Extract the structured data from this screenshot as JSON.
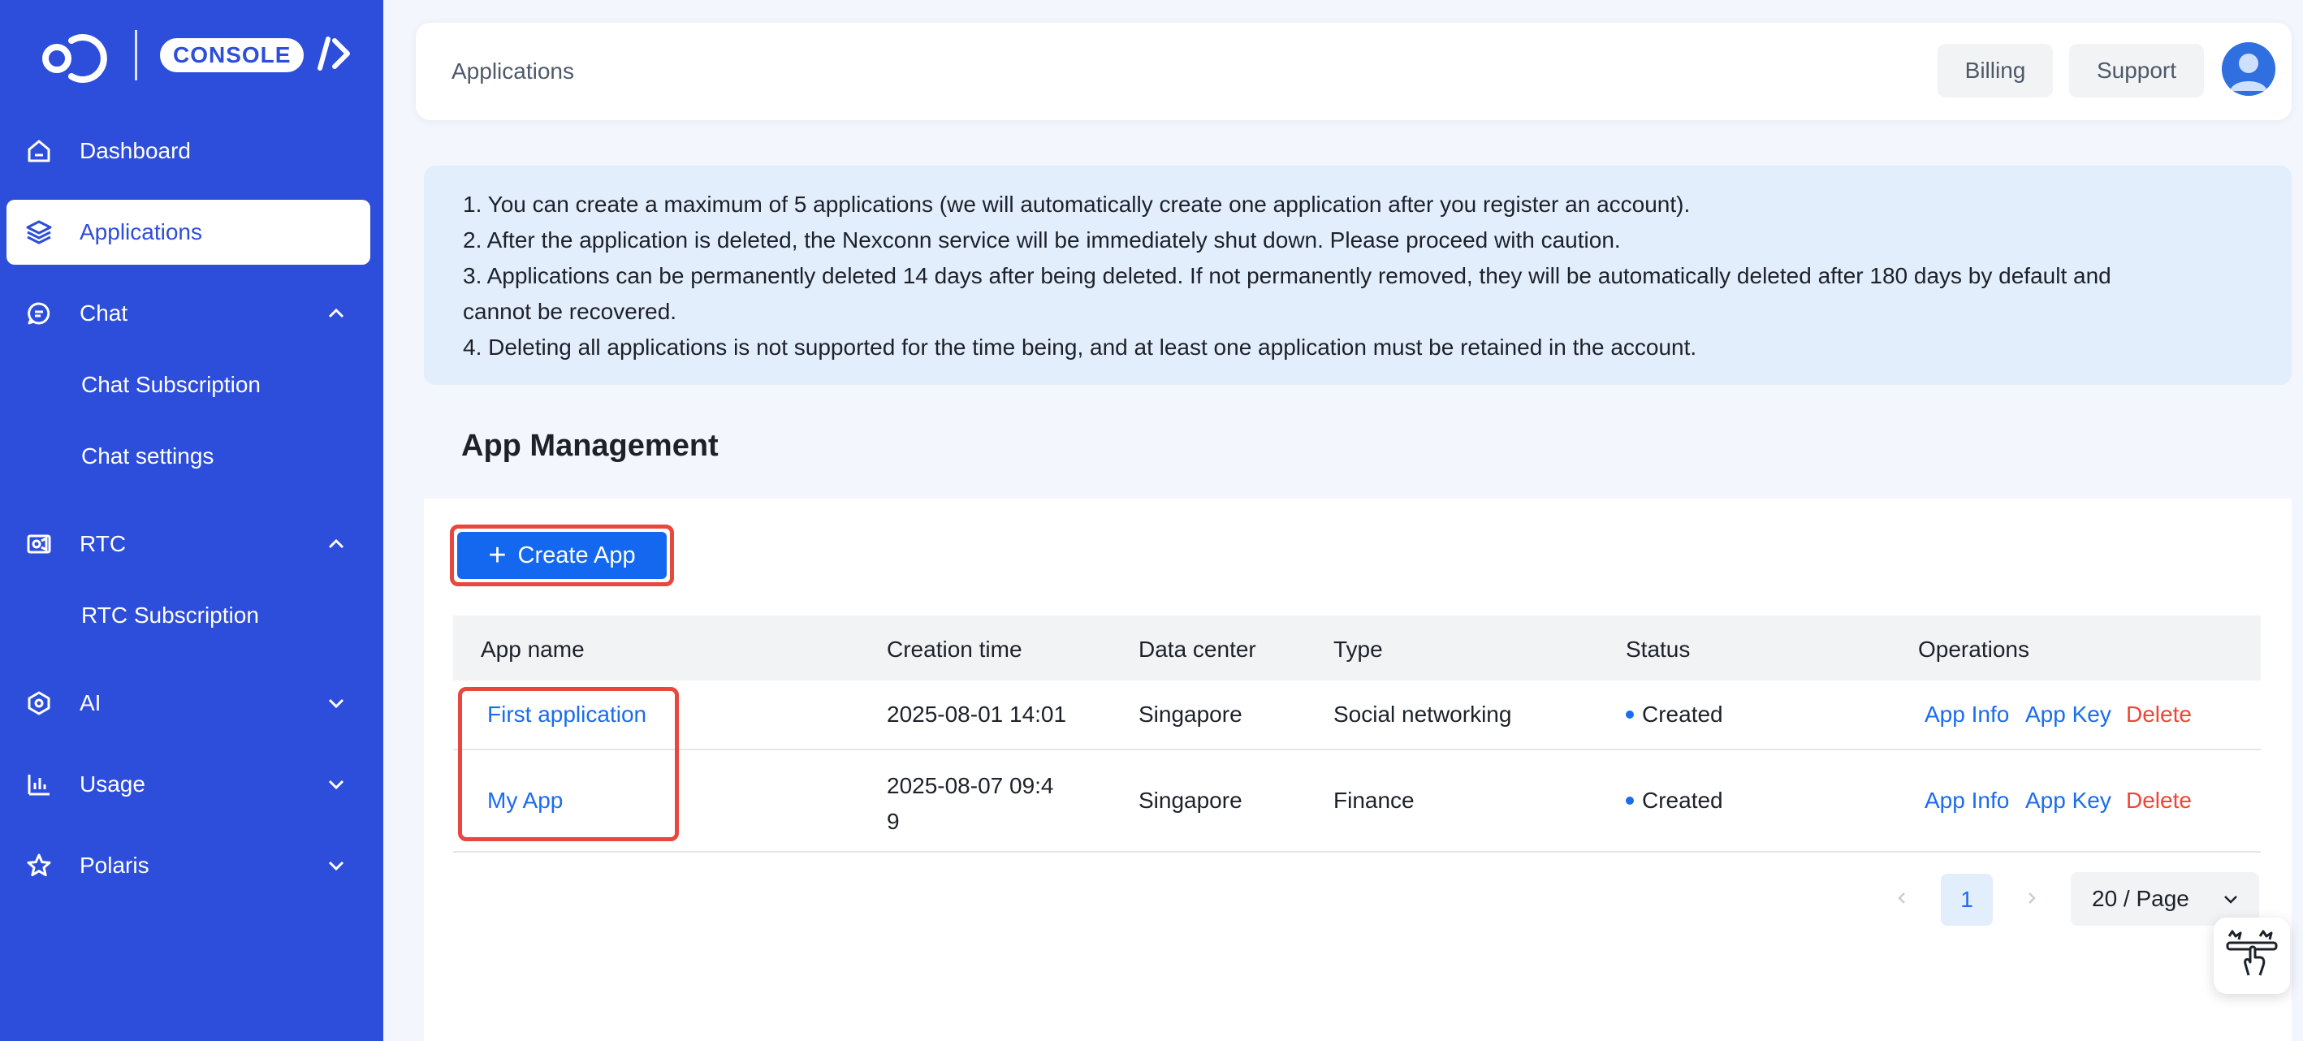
{
  "brand": {
    "badge": "CONSOLE"
  },
  "sidebar": {
    "items": [
      {
        "label": "Dashboard",
        "icon": "home-icon"
      },
      {
        "label": "Applications",
        "icon": "layers-icon",
        "active": true
      },
      {
        "label": "Chat",
        "icon": "chat-icon",
        "expanded": true
      },
      {
        "label": "RTC",
        "icon": "video-icon",
        "expanded": true
      },
      {
        "label": "AI",
        "icon": "ai-cube-icon",
        "expanded": false
      },
      {
        "label": "Usage",
        "icon": "bar-chart-icon",
        "expanded": false
      },
      {
        "label": "Polaris",
        "icon": "star-icon",
        "expanded": false
      }
    ],
    "chat_sub": [
      "Chat Subscription",
      "Chat settings"
    ],
    "rtc_sub": [
      "RTC Subscription"
    ]
  },
  "header": {
    "title": "Applications",
    "billing": "Billing",
    "support": "Support"
  },
  "notice": [
    "1. You can create a maximum of 5 applications (we will automatically create one application after you register an account).",
    "2. After the application is deleted, the Nexconn service will be immediately shut down. Please proceed with caution.",
    "3. Applications can be permanently deleted 14 days after being deleted. If not permanently removed, they will be automatically deleted after 180 days by default and",
    "cannot be recovered.",
    "4. Deleting all applications is not supported for the time being, and at least one application must be retained in the account."
  ],
  "main": {
    "section_title": "App Management",
    "create_label": "Create App",
    "columns": [
      "App name",
      "Creation time",
      "Data center",
      "Type",
      "Status",
      "Operations"
    ],
    "rows": [
      {
        "name": "First application",
        "time": "2025-08-01 14:01",
        "time_line2": "",
        "dc": "Singapore",
        "type": "Social networking",
        "status": "Created",
        "ops": [
          "App Info",
          "App Key",
          "Delete"
        ]
      },
      {
        "name": "My App",
        "time": "2025-08-07 09:4",
        "time_line2": "9",
        "dc": "Singapore",
        "type": "Finance",
        "status": "Created",
        "ops": [
          "App Info",
          "App Key",
          "Delete"
        ]
      }
    ]
  },
  "pagination": {
    "current": "1",
    "page_size": "20 / Page"
  },
  "colors": {
    "sidebar": "#2d4ddb",
    "primary": "#1468ef",
    "link": "#1a6cf0",
    "danger": "#ef4436",
    "highlight": "#e8463f"
  }
}
